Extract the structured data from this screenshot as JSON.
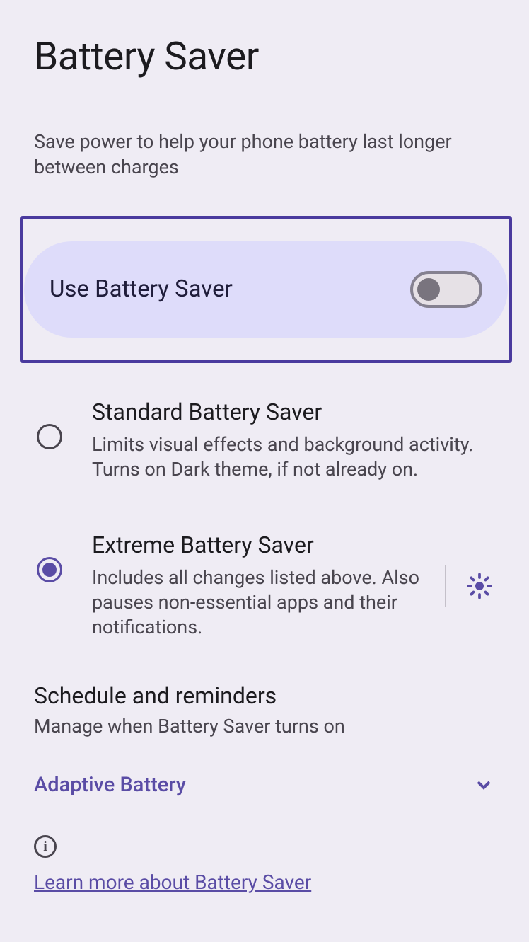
{
  "page": {
    "title": "Battery Saver",
    "subtitle": "Save power to help your phone battery last longer between charges"
  },
  "toggle": {
    "label": "Use Battery Saver",
    "enabled": false
  },
  "options": [
    {
      "title": "Standard Battery Saver",
      "desc": "Limits visual effects and background activity. Turns on Dark theme, if not already on.",
      "selected": false
    },
    {
      "title": "Extreme Battery Saver",
      "desc": "Includes all changes listed above. Also pauses non-essential apps and their notifications.",
      "selected": true
    }
  ],
  "schedule": {
    "title": "Schedule and reminders",
    "desc": "Manage when Battery Saver turns on"
  },
  "adaptive": {
    "label": "Adaptive Battery"
  },
  "learn_more": {
    "label": "Learn more about Battery Saver"
  },
  "colors": {
    "accent": "#5a4ca5",
    "highlight_border": "#4a3a9e",
    "toggle_card_bg": "#dedcfa"
  }
}
